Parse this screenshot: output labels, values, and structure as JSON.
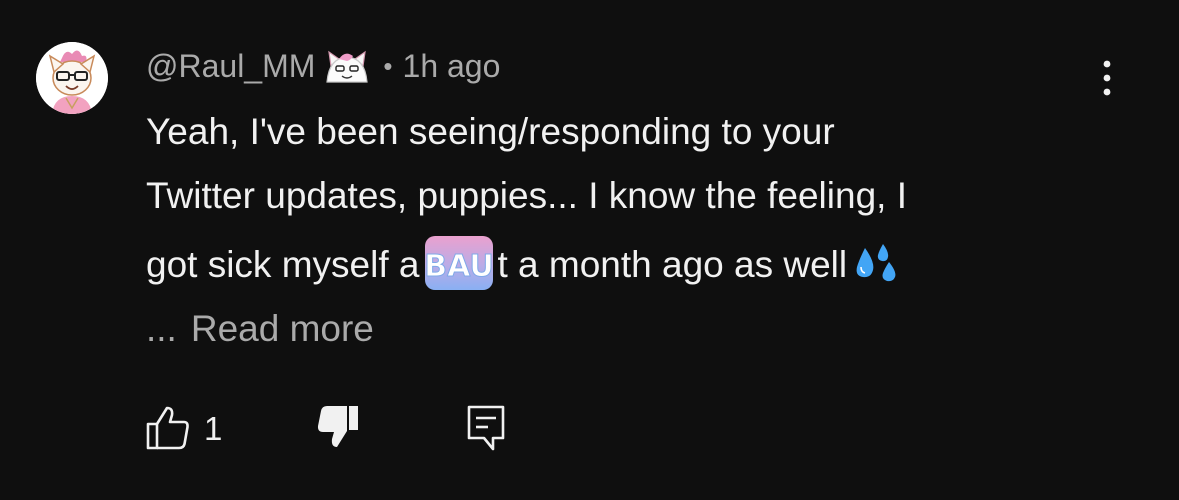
{
  "comment": {
    "username": "@Raul_MM",
    "separator": "•",
    "timestamp": "1h ago",
    "text_line1": "Yeah, I've been seeing/responding to your",
    "text_line2": "Twitter updates, puppies... I know the feeling, I",
    "text_line3_before": "got sick myself a",
    "emote_label": "BAU",
    "text_line3_after": "t a month ago as well",
    "read_more_ellipsis": "...",
    "read_more_label": "Read more",
    "like_count": "1"
  },
  "icons": {
    "more": "vertical-dots-icon",
    "like": "thumbs-up-icon",
    "dislike": "thumbs-down-icon",
    "reply": "comment-icon",
    "drops": "sweat-droplets-emoji"
  },
  "colors": {
    "background": "#0f0f0f",
    "primary_text": "#f1f1f1",
    "secondary_text": "#aaaaaa",
    "emote_pink": "#f6a8d8",
    "emote_blue": "#8fb8ff"
  }
}
